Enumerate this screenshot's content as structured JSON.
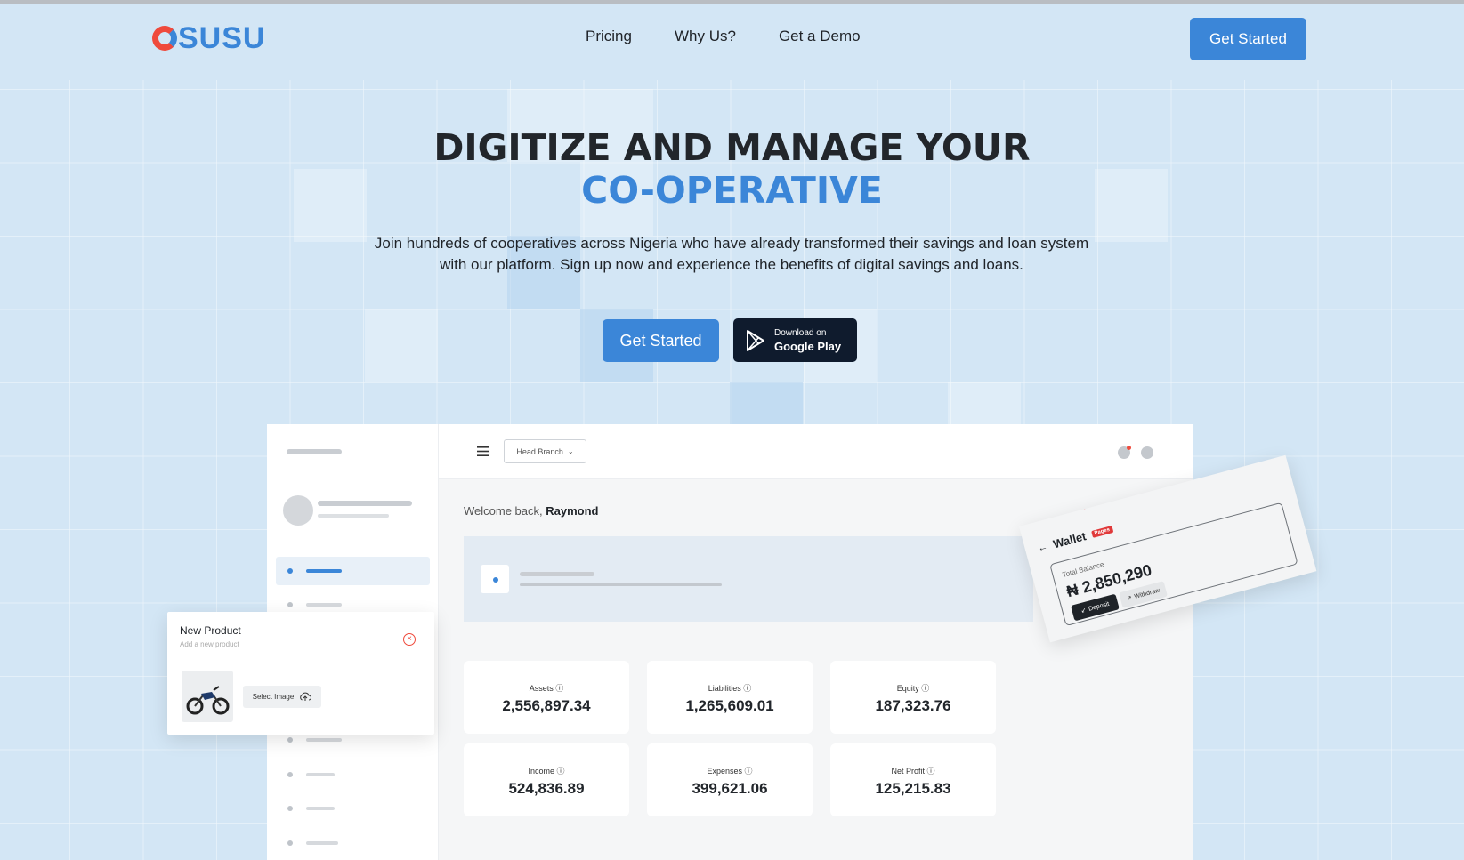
{
  "brand": {
    "logo_text": "SUSU",
    "colors": {
      "primary": "#3b86d8",
      "accent": "#ef4a3c",
      "dark": "#0f1b2d"
    }
  },
  "nav": {
    "links": [
      {
        "label": "Pricing"
      },
      {
        "label": "Why Us?"
      },
      {
        "label": "Get a Demo"
      }
    ],
    "cta_label": "Get Started"
  },
  "hero": {
    "title_line1": "DIGITIZE AND MANAGE YOUR",
    "title_line2": "CO-OPERATIVE",
    "subtitle": "Join hundreds of cooperatives across Nigeria who have already transformed their savings and loan system with our platform. Sign up now and experience the benefits of digital savings and loans.",
    "primary_cta": "Get Started",
    "play_button": {
      "small": "Download on",
      "big": "Google Play",
      "icon": "play-store-icon"
    }
  },
  "dashboard": {
    "branch_select": "Head Branch",
    "welcome_prefix": "Welcome back,",
    "welcome_name": "Raymond",
    "stats": [
      {
        "label": "Assets",
        "value": "2,556,897.34"
      },
      {
        "label": "Liabilities",
        "value": "1,265,609.01"
      },
      {
        "label": "Equity",
        "value": "187,323.76"
      },
      {
        "label": "Income",
        "value": "524,836.89"
      },
      {
        "label": "Expenses",
        "value": "399,621.06"
      },
      {
        "label": "Net Profit",
        "value": "125,215.83"
      }
    ]
  },
  "product_card": {
    "title": "New Product",
    "subtitle": "Add a new product",
    "select_label": "Select Image"
  },
  "wallet_card": {
    "title": "Wallet",
    "tag": "Pages",
    "balance_label": "Total Balance",
    "balance": "₦ 2,850,290",
    "deposit_label": "Deposit",
    "withdraw_label": "Withdraw"
  }
}
